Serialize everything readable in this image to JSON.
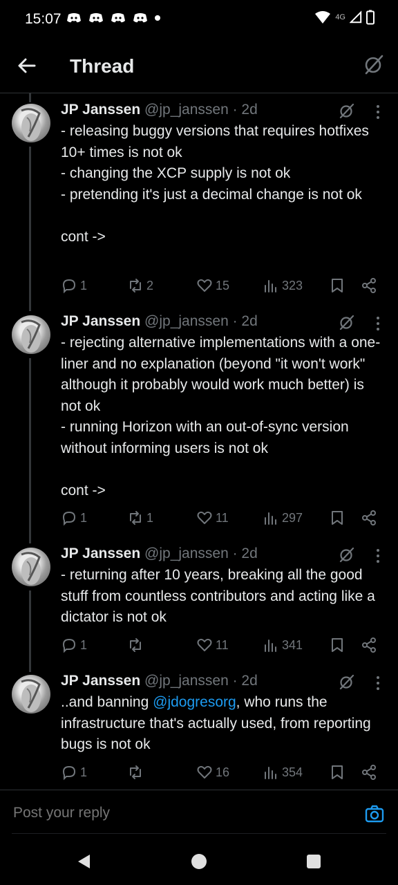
{
  "status": {
    "time": "15:07",
    "network": "4G"
  },
  "header": {
    "title": "Thread"
  },
  "posts": [
    {
      "name": "JP Janssen",
      "handle": "@jp_janssen · 2d",
      "text": "- releasing buggy versions that requires hotfixes 10+ times is not ok\n- changing the XCP supply is not ok\n- pretending it's just a decimal change is not ok\n\ncont ->",
      "replies": "1",
      "reposts": "2",
      "likes": "15",
      "views": "323"
    },
    {
      "name": "JP Janssen",
      "handle": "@jp_janssen · 2d",
      "text": "- rejecting alternative implementations with a one-liner and no explanation (beyond \"it won't work\" although it probably would work much better) is not ok\n- running Horizon with an out-of-sync version without informing users is not ok\n\ncont ->",
      "replies": "1",
      "reposts": "1",
      "likes": "11",
      "views": "297"
    },
    {
      "name": "JP Janssen",
      "handle": "@jp_janssen · 2d",
      "text": "- returning after 10 years, breaking all the good stuff from countless contributors and acting like a dictator is not ok",
      "replies": "1",
      "reposts": "",
      "likes": "11",
      "views": "341"
    },
    {
      "name": "JP Janssen",
      "handle": "@jp_janssen · 2d",
      "text_before": "..and banning ",
      "mention": "@jdogresorg",
      "text_after": ", who runs the infrastructure that's actually used, from reporting bugs is not ok",
      "replies": "1",
      "reposts": "",
      "likes": "16",
      "views": "354"
    }
  ],
  "reply": {
    "placeholder": "Post your reply"
  },
  "colors": {
    "background": "#000000",
    "text": "#e7e9ea",
    "muted": "#71767b",
    "accent": "#1d9bf0"
  }
}
